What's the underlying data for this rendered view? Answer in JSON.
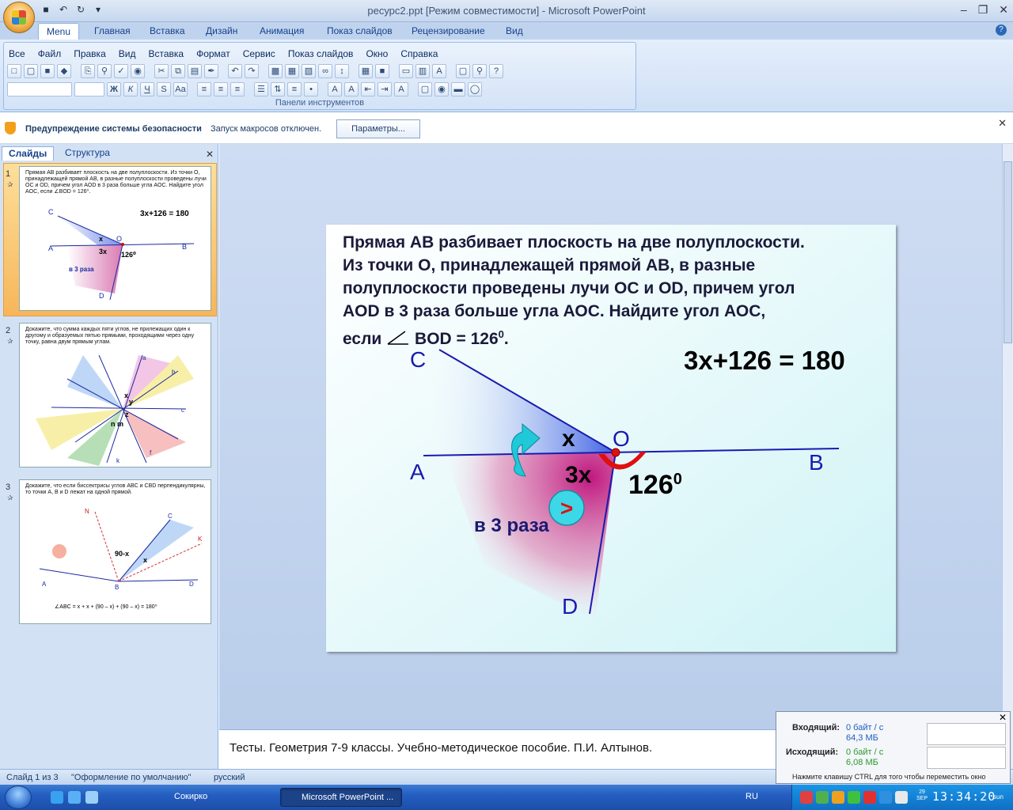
{
  "window": {
    "title": "ресурс2.ppt [Режим совместимости] - Microsoft PowerPoint"
  },
  "ribbon": {
    "tabs": [
      "Menu",
      "Главная",
      "Вставка",
      "Дизайн",
      "Анимация",
      "Показ слайдов",
      "Рецензирование",
      "Вид"
    ],
    "menu": [
      "Все",
      "Файл",
      "Правка",
      "Вид",
      "Вставка",
      "Формат",
      "Сервис",
      "Показ слайдов",
      "Окно",
      "Справка"
    ],
    "group_label": "Панели инструментов",
    "format_buttons": [
      "Ж",
      "К",
      "Ч",
      "S",
      "Aa"
    ]
  },
  "security": {
    "title": "Предупреждение системы безопасности",
    "message": "Запуск макросов отключен.",
    "button": "Параметры..."
  },
  "left_pane": {
    "tabs": [
      "Слайды",
      "Структура"
    ],
    "slides": [
      {
        "number": "1",
        "text": "Прямая AB разбивает плоскость на две полуплоскости. Из точки O, принадлежащей прямой AB, в разные полуплоскости проведены лучи OC и OD, причем угол AOD в 3 раза больше угла AOC. Найдите угол AOC, если ∠BOD = 126⁰.",
        "equation": "3х+126 = 180"
      },
      {
        "number": "2",
        "text": "Докажите, что сумма каждых пяти углов, не прилежащих один к другому и образуемых пятью прямыми, проходящими через одну точку, равна двум прямым углам."
      },
      {
        "number": "3",
        "text": "Докажите, что если биссектрисы углов ABC и CBD перпендикулярны, то точки A, B и D лежат на одной прямой.",
        "formula": "∠ABC = x + x + (90 – x) + (90 – x) = 180⁰"
      }
    ]
  },
  "slide": {
    "text_lines": [
      "Прямая АВ разбивает плоскость на две полуплоскости.",
      "Из точки О, принадлежащей прямой АВ, в разные",
      "полуплоскости проведены лучи ОС и OD, причем угол",
      "AOD в 3 раза больше угла АОС. Найдите угол АОС,"
    ],
    "text_last_prefix": "если",
    "text_last_rest": " BOD = 126",
    "text_last_sup": "0",
    "text_last_end": ".",
    "equation": "3х+126 = 180",
    "labels": {
      "c": "C",
      "a": "A",
      "o": "O",
      "b": "B",
      "d": "D",
      "x": "х",
      "three_x": "3х",
      "angle": "126",
      "angle_sup": "0",
      "times": "в 3 раза",
      "gt": ">"
    }
  },
  "notes": {
    "text": "Тесты. Геометрия 7-9 классы. Учебно-методическое пособие. П.И. Алтынов."
  },
  "status": {
    "slide": "Слайд 1 из 3",
    "theme": "\"Оформление по умолчанию\"",
    "language": "русский"
  },
  "network": {
    "in_label": "Входящий:",
    "in_rate": "0 байт / с",
    "in_total": "64,3 МБ",
    "out_label": "Исходящий:",
    "out_rate": "0 байт / с",
    "out_total": "6,08 МБ",
    "hint": "Нажмите клавишу CTRL для того чтобы переместить окно"
  },
  "taskbar": {
    "task1": "Сокирко",
    "task2": "Microsoft PowerPoint ...",
    "lang": "RU",
    "clock": "13:34:20",
    "date_day": "29",
    "date_month": "SEP",
    "weekday": "sun"
  }
}
